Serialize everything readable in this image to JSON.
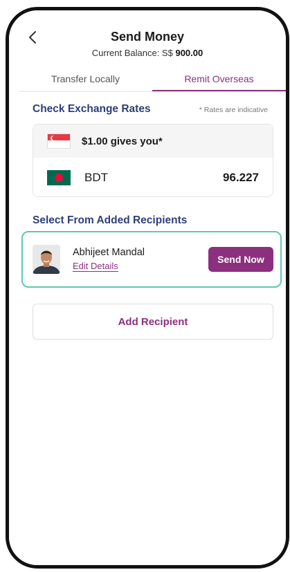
{
  "header": {
    "title": "Send Money",
    "balance_label": "Current Balance: S$",
    "balance_value": "900.00"
  },
  "tabs": [
    {
      "label": "Transfer Locally",
      "active": false
    },
    {
      "label": "Remit Overseas",
      "active": true
    }
  ],
  "exchange": {
    "title": "Check Exchange Rates",
    "note": "* Rates are indicative",
    "from_text": "$1.00 gives you*",
    "to_currency": "BDT",
    "rate": "96.227"
  },
  "recipients": {
    "title": "Select From Added Recipients",
    "items": [
      {
        "name": "Abhijeet Mandal",
        "edit_label": "Edit Details",
        "send_label": "Send Now"
      }
    ],
    "add_label": "Add Recipient"
  },
  "colors": {
    "accent": "#8b2f7f",
    "section_title": "#2c3f7a",
    "selected_border": "#5fc8b0"
  },
  "icons": {
    "back": "chevron-left-icon",
    "flag_from": "singapore-flag-icon",
    "flag_to": "bangladesh-flag-icon"
  }
}
